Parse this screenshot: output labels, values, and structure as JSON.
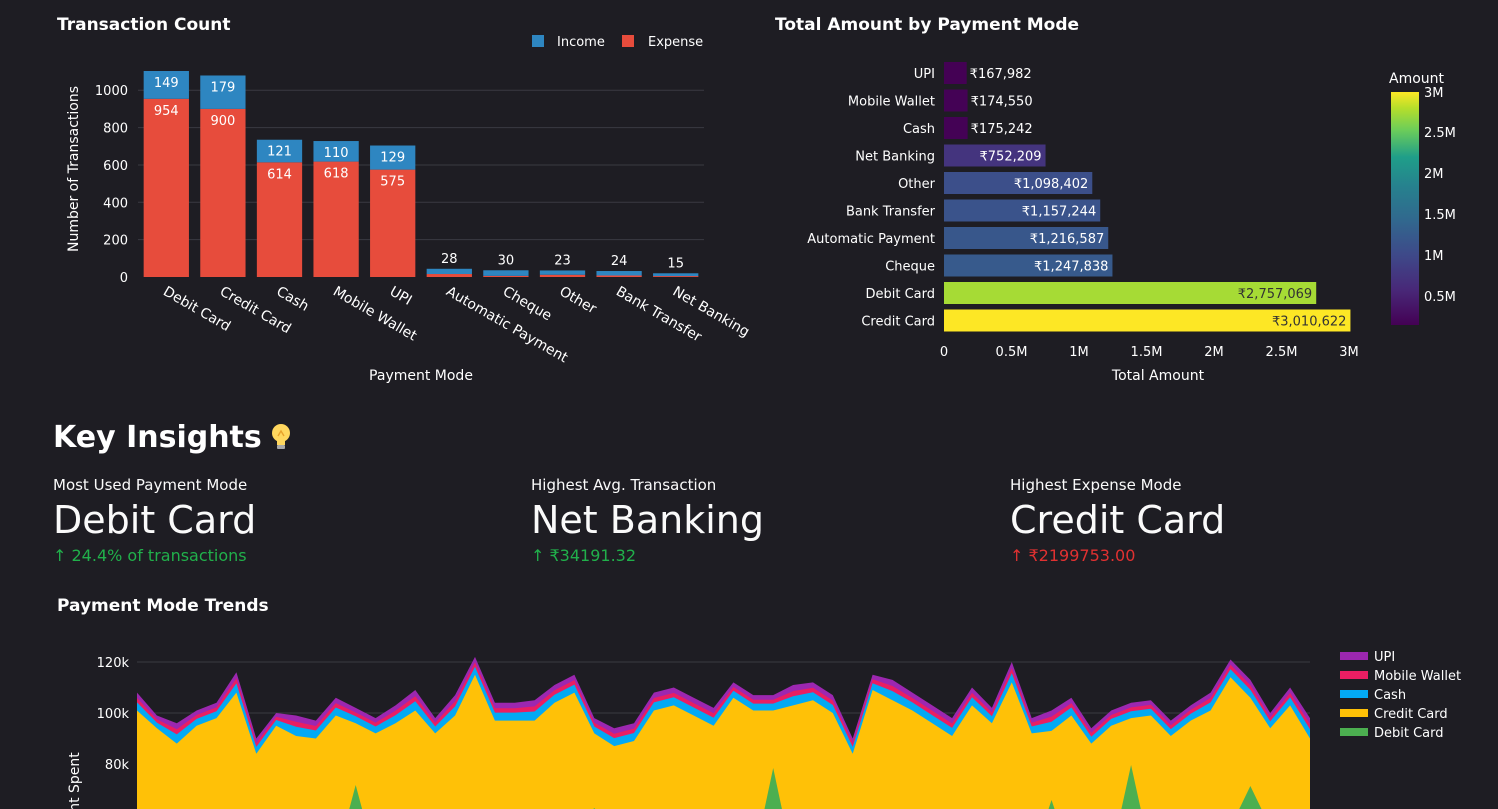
{
  "charts": {
    "tx_count": {
      "type": "bar",
      "title": "Transaction Count",
      "xlabel": "Payment Mode",
      "ylabel": "Number of Transactions",
      "ylim": [
        0,
        1103
      ],
      "yticks": [
        0,
        200,
        400,
        600,
        800,
        1000
      ],
      "categories": [
        "Debit Card",
        "Credit Card",
        "Cash",
        "Mobile Wallet",
        "UPI",
        "Automatic Payment",
        "Cheque",
        "Other",
        "Bank Transfer",
        "Net Banking"
      ],
      "series": [
        {
          "name": "Income",
          "color": "#2e86c1",
          "values": [
            149,
            179,
            121,
            110,
            129,
            28,
            30,
            23,
            24,
            15
          ]
        },
        {
          "name": "Expense",
          "color": "#e74c3c",
          "values": [
            954,
            900,
            614,
            618,
            575,
            16,
            6,
            12,
            8,
            5
          ]
        }
      ],
      "legend": "top-right"
    },
    "total_amount": {
      "type": "bar",
      "orientation": "horizontal",
      "title": "Total Amount by Payment Mode",
      "xlabel": "Total Amount",
      "xlim": [
        0,
        3000000
      ],
      "xticks": [
        "0",
        "0.5M",
        "1M",
        "1.5M",
        "2M",
        "2.5M",
        "3M"
      ],
      "categories": [
        "UPI",
        "Mobile Wallet",
        "Cash",
        "Net Banking",
        "Other",
        "Bank Transfer",
        "Automatic Payment",
        "Cheque",
        "Debit Card",
        "Credit Card"
      ],
      "values": [
        167982,
        174550,
        175242,
        752209,
        1098402,
        1157244,
        1216587,
        1247838,
        2757069,
        3010622
      ],
      "labels": [
        "₹167,982",
        "₹174,550",
        "₹175,242",
        "₹752,209",
        "₹1,098,402",
        "₹1,157,244",
        "₹1,216,587",
        "₹1,247,838",
        "₹2,757,069",
        "₹3,010,622"
      ],
      "colorscale": "viridis",
      "colorbar": {
        "title": "Amount",
        "ticks": [
          "3M",
          "2.5M",
          "2M",
          "1.5M",
          "1M",
          "0.5M"
        ]
      }
    },
    "trends": {
      "type": "area",
      "title": "Payment Mode Trends",
      "ylabel": "nt Spent",
      "yticks": [
        "120k",
        "100k",
        "80k"
      ],
      "ylim": [
        60000,
        125000
      ],
      "series": [
        {
          "name": "UPI",
          "color": "#9c27b0"
        },
        {
          "name": "Mobile Wallet",
          "color": "#e91e63"
        },
        {
          "name": "Cash",
          "color": "#03a9f4"
        },
        {
          "name": "Credit Card",
          "color": "#ffc107"
        },
        {
          "name": "Debit Card",
          "color": "#4caf50"
        }
      ],
      "top": [
        108000,
        99000,
        96000,
        101000,
        104000,
        116000,
        90000,
        100000,
        99000,
        97000,
        106000,
        102000,
        98000,
        103000,
        109000,
        98000,
        107000,
        122000,
        104000,
        104000,
        105000,
        111000,
        115000,
        98000,
        94000,
        96000,
        108000,
        110000,
        106000,
        102000,
        112000,
        107000,
        107000,
        111000,
        112000,
        107000,
        90000,
        115000,
        113000,
        108000,
        103000,
        98000,
        110000,
        102000,
        120000,
        98000,
        101000,
        106000,
        94000,
        101000,
        104000,
        105000,
        97000,
        103000,
        108000,
        121000,
        113000,
        100000,
        110000,
        98000
      ],
      "credit": [
        101000,
        94000,
        88000,
        95000,
        98000,
        108000,
        84000,
        95000,
        91000,
        90000,
        99000,
        96000,
        92000,
        96000,
        101000,
        92000,
        99000,
        115000,
        97000,
        97000,
        97000,
        104000,
        108000,
        92000,
        87000,
        89000,
        101000,
        103000,
        99000,
        95000,
        106000,
        101000,
        101000,
        103000,
        105000,
        100000,
        84000,
        109000,
        105000,
        101000,
        96000,
        91000,
        103000,
        96000,
        112000,
        92000,
        93000,
        99000,
        88000,
        95000,
        98000,
        99000,
        91000,
        97000,
        101000,
        114000,
        106000,
        94000,
        103000,
        90000
      ],
      "debit": [
        0,
        0,
        0,
        0,
        0,
        0,
        0,
        0,
        0,
        0,
        0,
        0,
        0,
        0,
        0,
        0,
        0,
        0,
        0,
        0,
        0,
        0,
        0,
        0,
        0,
        0,
        0,
        0,
        0,
        0,
        0,
        0,
        0,
        0,
        0,
        0,
        0,
        0,
        0,
        0,
        0,
        0,
        0,
        0,
        0,
        0,
        0,
        0,
        0,
        0,
        0,
        0,
        0,
        0,
        0,
        0,
        0,
        0,
        0,
        0
      ]
    }
  },
  "insights": {
    "heading": "Key Insights",
    "metrics": [
      {
        "label": "Most Used Payment Mode",
        "value": "Debit Card",
        "delta": "24.4% of transactions",
        "delta_color": "#21b04b"
      },
      {
        "label": "Highest Avg. Transaction",
        "value": "Net Banking",
        "delta": "₹34191.32",
        "delta_color": "#21b04b"
      },
      {
        "label": "Highest Expense Mode",
        "value": "Credit Card",
        "delta": "₹2199753.00",
        "delta_color": "#e03131"
      }
    ]
  }
}
